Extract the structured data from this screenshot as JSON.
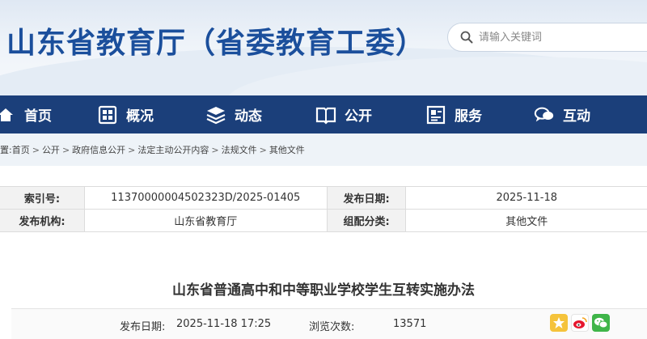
{
  "site": {
    "title": "山东省教育厅（省委教育工委）",
    "search_placeholder": "请输入关键词"
  },
  "nav": {
    "items": [
      {
        "label": "首页",
        "icon": "home-icon"
      },
      {
        "label": "概况",
        "icon": "building-icon"
      },
      {
        "label": "动态",
        "icon": "stack-icon"
      },
      {
        "label": "公开",
        "icon": "book-icon"
      },
      {
        "label": "服务",
        "icon": "service-icon"
      },
      {
        "label": "互动",
        "icon": "chat-icon"
      }
    ]
  },
  "breadcrumb": {
    "prefix": "置:",
    "items": [
      "首页",
      "公开",
      "政府信息公开",
      "法定主动公开内容",
      "法规文件",
      "其他文件"
    ]
  },
  "info": {
    "index_label": "索引号:",
    "index_value": "11370000004502323D/2025-01405",
    "pubdate_label": "发布日期:",
    "pubdate_value": "2025-11-18",
    "org_label": "发布机构:",
    "org_value": "山东省教育厅",
    "category_label": "组配分类:",
    "category_value": "其他文件"
  },
  "article": {
    "title": "山东省普通高中和中等职业学校学生互转实施办法",
    "pub_label": "发布日期:",
    "pub_value": "2025-11-18 17:25",
    "views_label": "浏览次数:",
    "views_value": "13571"
  },
  "colors": {
    "nav_bg": "#1b3f7a",
    "title_blue": "#1b4f9c",
    "breadcrumb_bg": "#eef3f8"
  },
  "share": [
    "qzone-star-icon",
    "weibo-icon",
    "wechat-icon"
  ]
}
